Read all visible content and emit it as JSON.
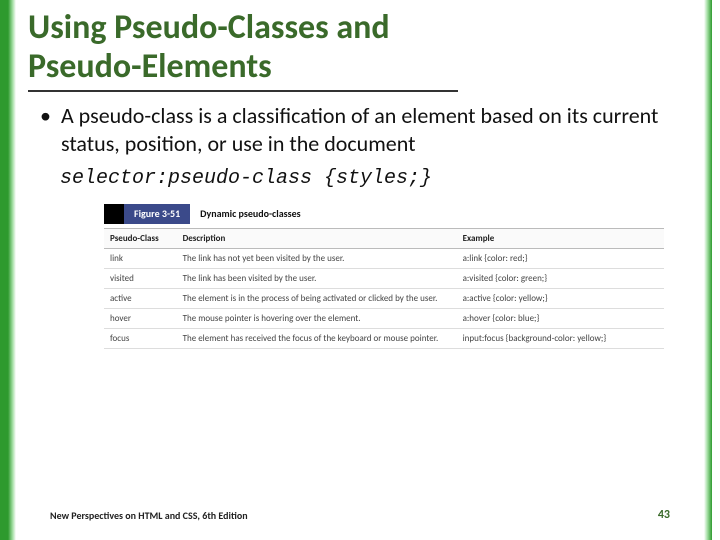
{
  "title": "Using Pseudo-Classes and Pseudo-Elements",
  "bullet_text": "A pseudo-class is a classification of an element based on its current status, position, or use in the document",
  "code_syntax": "selector:pseudo-class {styles;}",
  "figure": {
    "label": "Figure 3-51",
    "caption": "Dynamic pseudo-classes",
    "headers": [
      "Pseudo-Class",
      "Description",
      "Example"
    ],
    "rows": [
      {
        "pc": "link",
        "desc": "The link has not yet been visited by the user.",
        "ex": "a:link {color: red;}"
      },
      {
        "pc": "visited",
        "desc": "The link has been visited by the user.",
        "ex": "a:visited {color: green;}"
      },
      {
        "pc": "active",
        "desc": "The element is in the process of being activated or clicked by the user.",
        "ex": "a:active {color: yellow;}"
      },
      {
        "pc": "hover",
        "desc": "The mouse pointer is hovering over the element.",
        "ex": "a:hover {color: blue;}"
      },
      {
        "pc": "focus",
        "desc": "The element has received the focus of the keyboard or mouse pointer.",
        "ex": "input:focus {background-color: yellow;}"
      }
    ]
  },
  "footer": {
    "book": "New Perspectives on HTML and CSS, 6th Edition",
    "page": "43"
  }
}
